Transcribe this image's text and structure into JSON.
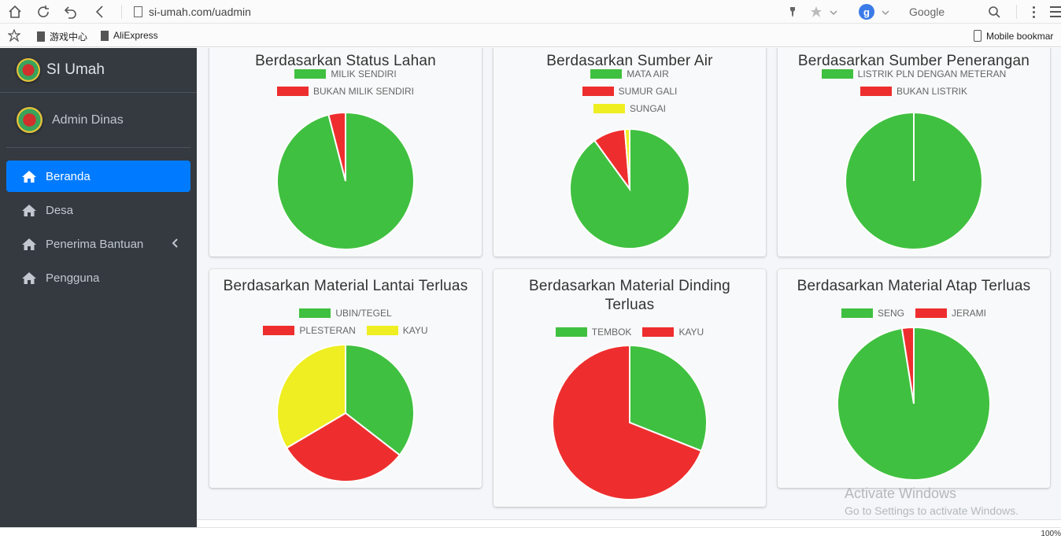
{
  "browser": {
    "url": "si-umah.com/uadmin",
    "search_engine_label": "Google",
    "bookmarks": [
      "游戏中心",
      "AliExpress"
    ],
    "mobile_bookmarks": "Mobile bookmar",
    "zoom": "100%"
  },
  "sidebar": {
    "brand": "SI Umah",
    "user": "Admin Dinas",
    "menu": [
      {
        "label": "Beranda",
        "active": true
      },
      {
        "label": "Desa"
      },
      {
        "label": "Penerima Bantuan",
        "has_submenu": true
      },
      {
        "label": "Pengguna"
      }
    ]
  },
  "colors": {
    "green": "#40c040",
    "red": "#ee2e2e",
    "yellow": "#eeee22",
    "sidebar": "#343a40",
    "active": "#007bff"
  },
  "chart_data": [
    {
      "type": "pie",
      "title": "Berdasarkan Status Lahan",
      "series": [
        {
          "name": "MILIK SENDIRI",
          "value": 96,
          "color": "#40c040"
        },
        {
          "name": "BUKAN MILIK SENDIRI",
          "value": 4,
          "color": "#ee2e2e"
        }
      ]
    },
    {
      "type": "pie",
      "title": "Berdasarkan Sumber Air",
      "series": [
        {
          "name": "MATA AIR",
          "value": 90,
          "color": "#40c040"
        },
        {
          "name": "SUMUR GALI",
          "value": 8.7,
          "color": "#ee2e2e"
        },
        {
          "name": "SUNGAI",
          "value": 1.3,
          "color": "#eeee22"
        }
      ]
    },
    {
      "type": "pie",
      "title": "Berdasarkan Sumber Penerangan",
      "series": [
        {
          "name": "LISTRIK PLN DENGAN METERAN",
          "value": 100,
          "color": "#40c040"
        },
        {
          "name": "BUKAN LISTRIK",
          "value": 0,
          "color": "#ee2e2e"
        }
      ]
    },
    {
      "type": "pie",
      "title": "Berdasarkan Material Lantai Terluas",
      "series": [
        {
          "name": "UBIN/TEGEL",
          "value": 35.5,
          "color": "#40c040"
        },
        {
          "name": "PLESTERAN",
          "value": 31,
          "color": "#ee2e2e"
        },
        {
          "name": "KAYU",
          "value": 33.5,
          "color": "#eeee22"
        }
      ]
    },
    {
      "type": "pie",
      "title": "Berdasarkan Material Dinding Terluas",
      "series": [
        {
          "name": "TEMBOK",
          "value": 31,
          "color": "#40c040"
        },
        {
          "name": "KAYU",
          "value": 69,
          "color": "#ee2e2e"
        }
      ]
    },
    {
      "type": "pie",
      "title": "Berdasarkan Material Atap Terluas",
      "series": [
        {
          "name": "SENG",
          "value": 97.5,
          "color": "#40c040"
        },
        {
          "name": "JERAMI",
          "value": 2.5,
          "color": "#ee2e2e"
        }
      ]
    }
  ],
  "watermark": {
    "title": "Activate Windows",
    "subtitle": "Go to Settings to activate Windows."
  }
}
